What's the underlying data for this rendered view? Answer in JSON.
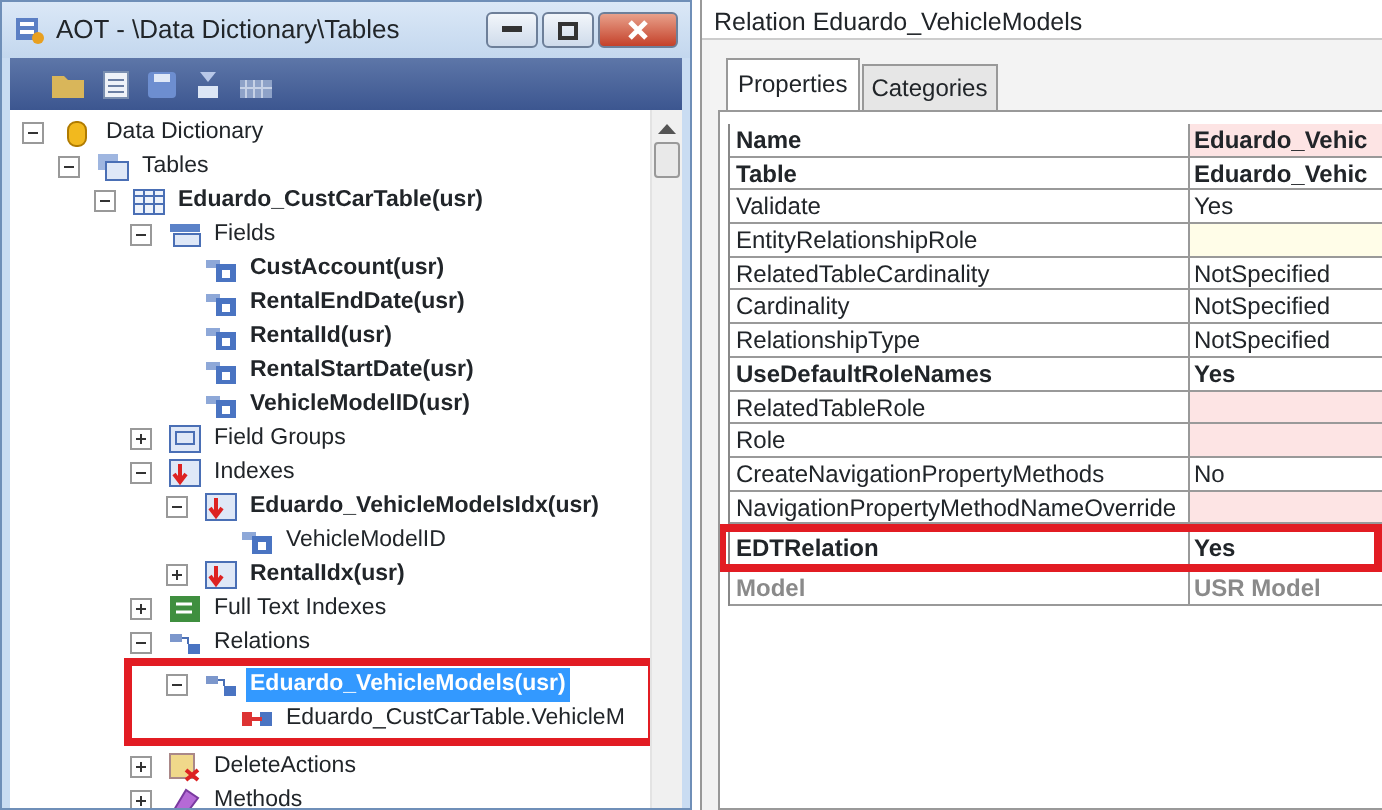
{
  "aot_window": {
    "title": "AOT - \\Data Dictionary\\Tables",
    "tree": [
      {
        "label": "Data Dictionary",
        "kind": "database",
        "bold": false,
        "expanded": true,
        "selected": false,
        "highlighted": false,
        "children": [
          {
            "label": "Tables",
            "kind": "tables",
            "bold": false,
            "expanded": true,
            "selected": false,
            "highlighted": false,
            "children": [
              {
                "label": "Eduardo_CustCarTable(usr)",
                "kind": "table",
                "bold": true,
                "expanded": true,
                "selected": false,
                "highlighted": false,
                "children": [
                  {
                    "label": "Fields",
                    "kind": "fields",
                    "bold": false,
                    "expanded": true,
                    "selected": false,
                    "highlighted": false,
                    "children": [
                      {
                        "label": "CustAccount(usr)",
                        "kind": "field",
                        "bold": true,
                        "selected": false,
                        "highlighted": false
                      },
                      {
                        "label": "RentalEndDate(usr)",
                        "kind": "field",
                        "bold": true,
                        "selected": false,
                        "highlighted": false
                      },
                      {
                        "label": "RentalId(usr)",
                        "kind": "field",
                        "bold": true,
                        "selected": false,
                        "highlighted": false
                      },
                      {
                        "label": "RentalStartDate(usr)",
                        "kind": "field",
                        "bold": true,
                        "selected": false,
                        "highlighted": false
                      },
                      {
                        "label": "VehicleModelID(usr)",
                        "kind": "field",
                        "bold": true,
                        "selected": false,
                        "highlighted": false
                      }
                    ]
                  },
                  {
                    "label": "Field Groups",
                    "kind": "group",
                    "bold": false,
                    "expanded": false,
                    "selected": false,
                    "highlighted": false
                  },
                  {
                    "label": "Indexes",
                    "kind": "index",
                    "bold": false,
                    "expanded": true,
                    "selected": false,
                    "highlighted": false,
                    "children": [
                      {
                        "label": "Eduardo_VehicleModelsIdx(usr)",
                        "kind": "index",
                        "bold": true,
                        "expanded": true,
                        "selected": false,
                        "highlighted": false,
                        "children": [
                          {
                            "label": "VehicleModelID",
                            "kind": "field",
                            "bold": false,
                            "selected": false,
                            "highlighted": false
                          }
                        ]
                      },
                      {
                        "label": "RentalIdx(usr)",
                        "kind": "index",
                        "bold": true,
                        "expanded": false,
                        "selected": false,
                        "highlighted": false
                      }
                    ]
                  },
                  {
                    "label": "Full Text Indexes",
                    "kind": "fulltext",
                    "bold": false,
                    "expanded": false,
                    "selected": false,
                    "highlighted": false
                  },
                  {
                    "label": "Relations",
                    "kind": "relation",
                    "bold": false,
                    "expanded": true,
                    "selected": false,
                    "highlighted": false,
                    "children": [
                      {
                        "label": "Eduardo_VehicleModels(usr)",
                        "kind": "relation",
                        "bold": true,
                        "expanded": true,
                        "selected": true,
                        "highlighted": true,
                        "children": [
                          {
                            "label": "Eduardo_CustCarTable.VehicleM",
                            "kind": "link",
                            "bold": false,
                            "selected": false,
                            "highlighted": false
                          }
                        ]
                      }
                    ]
                  },
                  {
                    "label": "DeleteActions",
                    "kind": "delete",
                    "bold": false,
                    "expanded": false,
                    "selected": false,
                    "highlighted": false
                  },
                  {
                    "label": "Methods",
                    "kind": "methods",
                    "bold": false,
                    "expanded": false,
                    "selected": false,
                    "highlighted": false
                  }
                ]
              }
            ]
          }
        ]
      }
    ]
  },
  "property_panel": {
    "title": "Relation Eduardo_VehicleModels",
    "tabs": [
      {
        "label": "Properties",
        "selected": true
      },
      {
        "label": "Categories",
        "selected": false
      }
    ],
    "properties": [
      {
        "name": "Name",
        "value": "Eduardo_Vehic",
        "bold": true,
        "disabled": false,
        "highlighted": false,
        "color": "#fde4e4"
      },
      {
        "name": "Table",
        "value": "Eduardo_Vehic",
        "bold": true,
        "disabled": false,
        "highlighted": false,
        "color": "#ffffff"
      },
      {
        "name": "Validate",
        "value": "Yes",
        "bold": false,
        "disabled": false,
        "highlighted": false,
        "color": "#ffffff"
      },
      {
        "name": "EntityRelationshipRole",
        "bold": false,
        "disabled": false,
        "highlighted": false,
        "color": "#fffde8"
      },
      {
        "name": "RelatedTableCardinality",
        "value": "NotSpecified",
        "bold": false,
        "disabled": false,
        "highlighted": false,
        "color": "#ffffff"
      },
      {
        "name": "Cardinality",
        "value": "NotSpecified",
        "bold": false,
        "disabled": false,
        "highlighted": false,
        "color": "#ffffff"
      },
      {
        "name": "RelationshipType",
        "value": "NotSpecified",
        "bold": false,
        "disabled": false,
        "highlighted": false,
        "color": "#ffffff"
      },
      {
        "name": "UseDefaultRoleNames",
        "value": "Yes",
        "bold": true,
        "disabled": false,
        "highlighted": false,
        "color": "#ffffff"
      },
      {
        "name": "RelatedTableRole",
        "bold": false,
        "disabled": false,
        "highlighted": false,
        "color": "#fde4e4"
      },
      {
        "name": "Role",
        "bold": false,
        "disabled": false,
        "highlighted": false,
        "color": "#fde4e4"
      },
      {
        "name": "CreateNavigationPropertyMethods",
        "value": "No",
        "bold": false,
        "disabled": false,
        "highlighted": false,
        "color": "#ffffff"
      },
      {
        "name": "NavigationPropertyMethodNameOverride",
        "bold": false,
        "disabled": false,
        "highlighted": false,
        "color": "#fde4e4"
      },
      {
        "name": "EDTRelation",
        "value": "Yes",
        "bold": true,
        "disabled": false,
        "highlighted": true,
        "color": "#ffffff"
      },
      {
        "name": "Model",
        "value": "USR Model",
        "bold": true,
        "disabled": true,
        "highlighted": false,
        "color": "#ffffff"
      }
    ]
  }
}
